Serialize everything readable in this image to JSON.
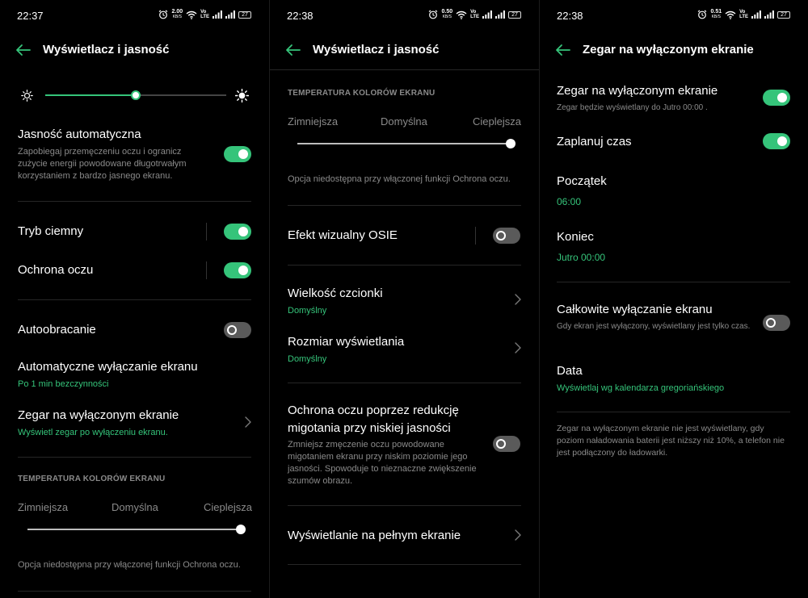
{
  "screens": [
    {
      "time": "22:37",
      "net_speed": "2.00",
      "net_unit": "KB/S",
      "battery": "27",
      "title": "Wyświetlacz i jasność",
      "auto_brightness": {
        "label": "Jasność automatyczna",
        "desc": "Zapobiegaj przemęczeniu oczu i ogranicz zużycie energii powodowane długotrwałym korzystaniem z bardzo jasnego ekranu.",
        "enabled": true
      },
      "brightness_level": 0.5,
      "dark_mode": {
        "label": "Tryb ciemny",
        "enabled": true
      },
      "eye_protection": {
        "label": "Ochrona oczu",
        "enabled": true
      },
      "auto_rotate": {
        "label": "Autoobracanie",
        "enabled": false
      },
      "screen_timeout": {
        "label": "Automatyczne wyłączanie ekranu",
        "value": "Po 1 min bezczynności"
      },
      "aod": {
        "label": "Zegar na wyłączonym ekranie",
        "value": "Wyświetl zegar po wyłączeniu ekranu."
      },
      "color_temp": {
        "section": "TEMPERATURA KOLORÓW EKRANU",
        "labels": [
          "Zimniejsza",
          "Domyślna",
          "Cieplejsza"
        ],
        "note": "Opcja niedostępna przy włączonej funkcji Ochrona oczu.",
        "level": 1.0
      }
    },
    {
      "time": "22:38",
      "net_speed": "0.50",
      "net_unit": "KB/S",
      "battery": "27",
      "title": "Wyświetlacz i jasność",
      "color_temp": {
        "section": "TEMPERATURA KOLORÓW EKRANU",
        "labels": [
          "Zimniejsza",
          "Domyślna",
          "Cieplejsza"
        ],
        "note": "Opcja niedostępna przy włączonej funkcji Ochrona oczu.",
        "level": 1.0
      },
      "osie": {
        "label": "Efekt wizualny OSIE",
        "enabled": false
      },
      "font_size": {
        "label": "Wielkość czcionki",
        "value": "Domyślny"
      },
      "display_size": {
        "label": "Rozmiar wyświetlania",
        "value": "Domyślny"
      },
      "flicker": {
        "label_line1": "Ochrona oczu poprzez redukcję",
        "label_line2": "migotania przy niskiej jasności",
        "desc": "Zmniejsz zmęczenie oczu powodowane migotaniem ekranu przy niskim poziomie jego jasności. Spowoduje to nieznaczne zwiększenie szumów obrazu.",
        "enabled": false
      },
      "fullscreen": {
        "label": "Wyświetlanie na pełnym ekranie"
      }
    },
    {
      "time": "22:38",
      "net_speed": "0.51",
      "net_unit": "KB/S",
      "battery": "27",
      "title": "Zegar na wyłączonym ekranie",
      "aod": {
        "label": "Zegar na wyłączonym ekranie",
        "desc": "Zegar będzie wyświetlany do Jutro  00:00 .",
        "enabled": true
      },
      "schedule": {
        "label": "Zaplanuj czas",
        "enabled": true
      },
      "start": {
        "label": "Początek",
        "value": "06:00"
      },
      "end": {
        "label": "Koniec",
        "value": "Jutro 00:00"
      },
      "full_off": {
        "label": "Całkowite wyłączanie ekranu",
        "desc": "Gdy ekran jest wyłączony, wyświetlany jest tylko czas.",
        "enabled": false
      },
      "date": {
        "label": "Data",
        "value": "Wyświetlaj wg kalendarza gregoriańskiego"
      },
      "footer": "Zegar na wyłączonym ekranie nie jest wyświetlany, gdy poziom naładowania baterii jest niższy niż 10%, a telefon nie jest podłączony do ładowarki."
    }
  ],
  "colors": {
    "accent": "#35c47a",
    "background": "#000000",
    "secondary_text": "#8a8a8a"
  },
  "icons": [
    "back-arrow-icon",
    "alarm-icon",
    "wifi-icon",
    "signal-icon",
    "battery-icon",
    "sun-small-icon",
    "sun-large-icon",
    "chevron-right-icon"
  ]
}
